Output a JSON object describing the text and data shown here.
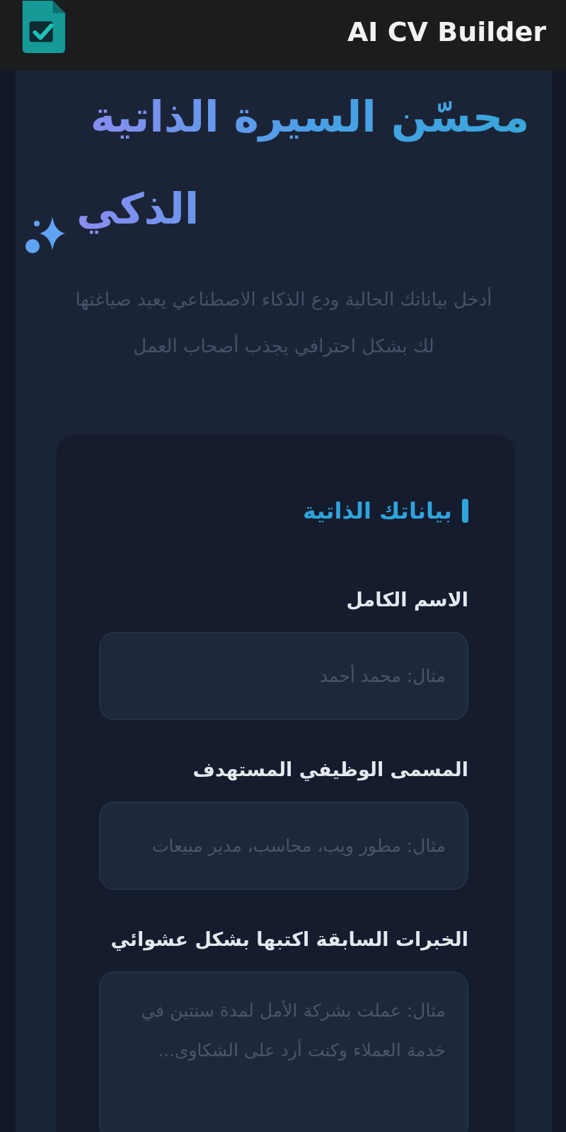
{
  "header": {
    "app_name": "AI CV Builder"
  },
  "hero": {
    "title": "محسّن السيرة الذاتية الذكي",
    "subtitle": "أدخل بياناتك الحالية ودع الذكاء الاصطناعي يعيد صياغتها لك بشكل احترافي يجذب أصحاب العمل"
  },
  "form": {
    "section_title": "بياناتك الذاتية",
    "fields": [
      {
        "kind": "input",
        "label": "الاسم الكامل",
        "placeholder": "مثال: محمد أحمد"
      },
      {
        "kind": "input",
        "label": "المسمى الوظيفي المستهدف",
        "placeholder": "مثال: مطور ويب، محاسب، مدير مبيعات"
      },
      {
        "kind": "textarea",
        "label": "الخبرات السابقة اكتبها بشكل عشوائي",
        "placeholder": "مثال: عملت بشركة الأمل لمدة سنتين في خدمة العملاء وكنت أرد على الشكاوى..."
      }
    ]
  }
}
